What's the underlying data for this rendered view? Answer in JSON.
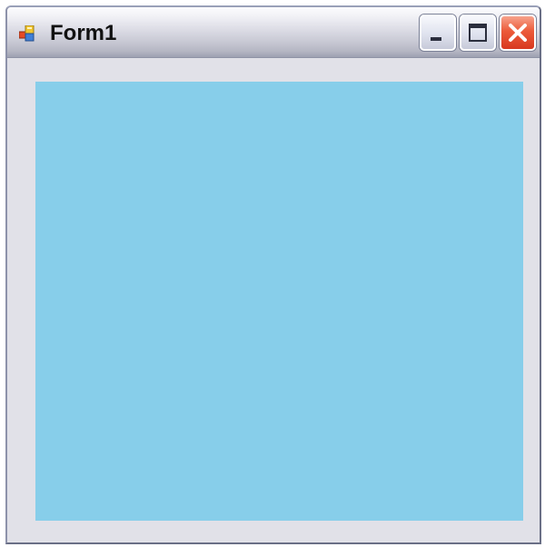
{
  "window": {
    "title": "Form1",
    "app_icon": "form-app-icon",
    "controls": {
      "minimize_icon": "minimize-icon",
      "maximize_icon": "maximize-icon",
      "close_icon": "close-icon"
    }
  },
  "colors": {
    "client_background": "#e1e1e8",
    "panel": "#87ceea",
    "close_button": "#e14d2c"
  }
}
